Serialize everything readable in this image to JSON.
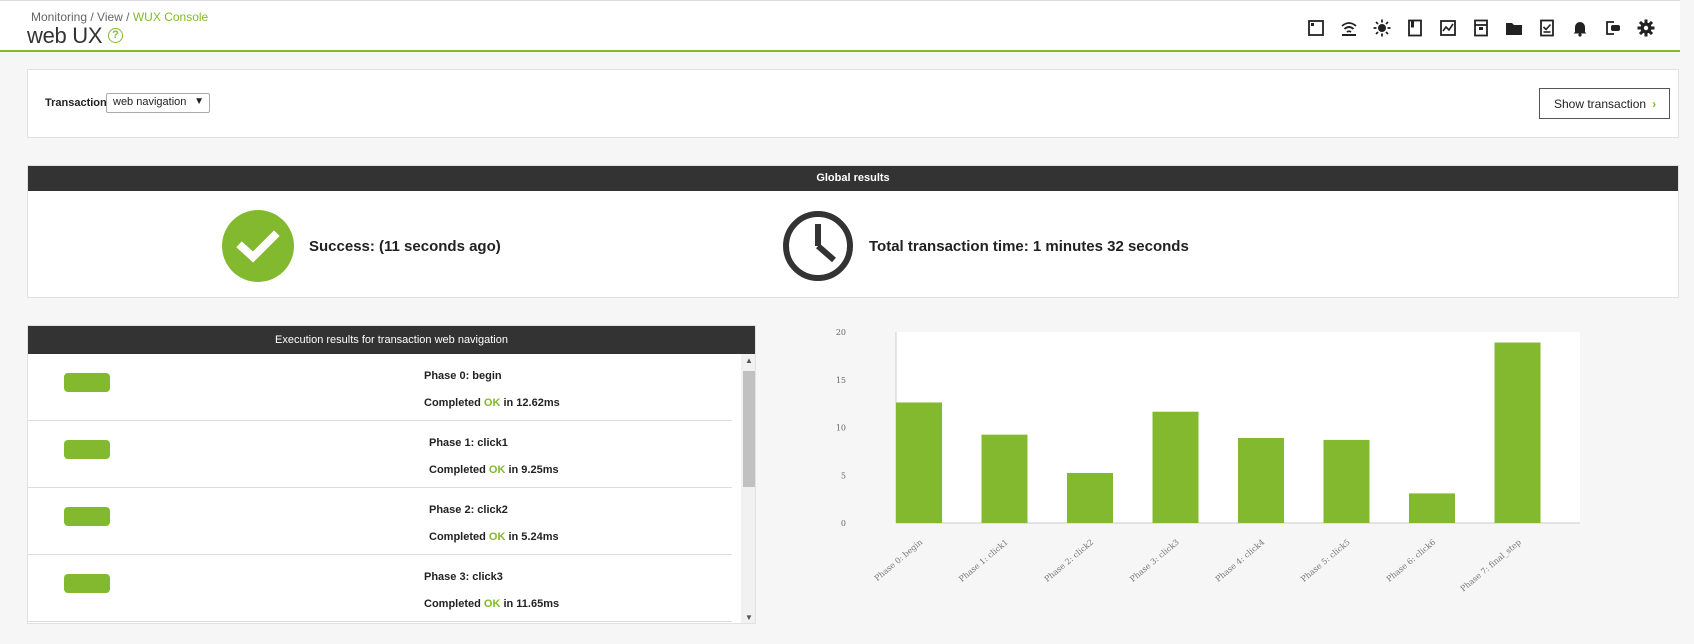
{
  "header": {
    "breadcrumb": [
      {
        "label": "Monitoring"
      },
      {
        "label": "View"
      },
      {
        "label": "WUX Console"
      }
    ],
    "separator": " / ",
    "title": "web UX",
    "help_glyph": "?"
  },
  "toolbar": {
    "icons": [
      "window-icon",
      "wifi-icon",
      "sun-icon",
      "bookmark-icon",
      "chart-icon",
      "archive-icon",
      "folder-icon",
      "checklist-icon",
      "bell-icon",
      "logout-icon",
      "gear-icon"
    ]
  },
  "transaction": {
    "label": "Transaction",
    "selected": "web navigation",
    "arrow": "▼",
    "show_button": "Show transaction",
    "show_chevron": "›"
  },
  "global": {
    "title": "Global results",
    "success": "Success: (11 seconds ago)",
    "total_time": "Total transaction time: 1 minutes 32 seconds",
    "accent": "#82b92e"
  },
  "execution": {
    "title": "Execution results for transaction web navigation",
    "rows": [
      {
        "phase": "Phase 0: begin",
        "completed": "Completed ",
        "ok": "OK",
        "time": " in 12.62ms"
      },
      {
        "phase": "Phase 1: click1",
        "completed": "Completed ",
        "ok": "OK",
        "time": " in 9.25ms"
      },
      {
        "phase": "Phase 2: click2",
        "completed": "Completed ",
        "ok": "OK",
        "time": " in 5.24ms"
      },
      {
        "phase": "Phase 3: click3",
        "completed": "Completed ",
        "ok": "OK",
        "time": " in 11.65ms"
      }
    ],
    "scroll_up": "▲",
    "scroll_down": "▼"
  },
  "chart_data": {
    "type": "bar",
    "categories": [
      "Phase 0: begin",
      "Phase 1: click1",
      "Phase 2: click2",
      "Phase 3: click3",
      "Phase 4: click4",
      "Phase 5: click5",
      "Phase 6: click6",
      "Phase 7: final_step"
    ],
    "values": [
      12.62,
      9.25,
      5.24,
      11.65,
      8.9,
      8.7,
      3.1,
      18.9
    ],
    "yticks": [
      0,
      5,
      10,
      15,
      20
    ],
    "ylim": [
      0,
      20
    ],
    "color": "#82b92e"
  }
}
